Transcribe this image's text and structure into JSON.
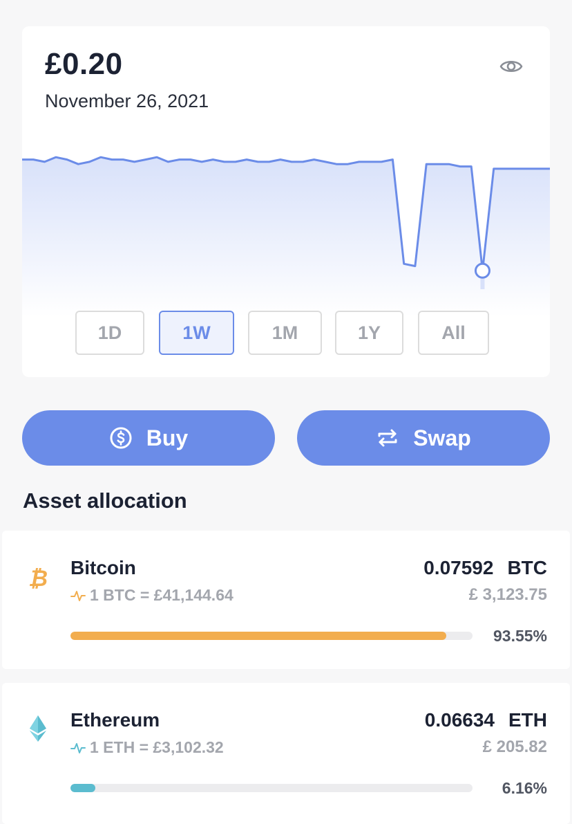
{
  "summary": {
    "balance": "£0.20",
    "date": "November 26, 2021",
    "visibility_icon": "eye-icon",
    "chart_data": {
      "type": "area",
      "description_points": [
        {
          "series": "portfolio",
          "selected_index": 41
        }
      ],
      "y": [
        0.5,
        0.5,
        0.49,
        0.51,
        0.5,
        0.48,
        0.49,
        0.51,
        0.5,
        0.5,
        0.49,
        0.5,
        0.51,
        0.49,
        0.5,
        0.5,
        0.49,
        0.5,
        0.49,
        0.49,
        0.5,
        0.49,
        0.49,
        0.5,
        0.49,
        0.49,
        0.5,
        0.49,
        0.48,
        0.48,
        0.49,
        0.49,
        0.49,
        0.5,
        0.05,
        0.04,
        0.48,
        0.48,
        0.48,
        0.47,
        0.47,
        0.02,
        0.46,
        0.46,
        0.46,
        0.46,
        0.46,
        0.46
      ],
      "line_color": "#6b8ce8",
      "fill_color": "#e3e9fb"
    },
    "ranges": [
      {
        "label": "1D",
        "active": false
      },
      {
        "label": "1W",
        "active": true
      },
      {
        "label": "1M",
        "active": false
      },
      {
        "label": "1Y",
        "active": false
      },
      {
        "label": "All",
        "active": false
      }
    ]
  },
  "actions": {
    "buy_label": "Buy",
    "buy_icon": "dollar-circle-icon",
    "swap_label": "Swap",
    "swap_icon": "swap-arrows-icon",
    "accent": "#6b8ce8"
  },
  "allocation": {
    "title": "Asset allocation",
    "assets": [
      {
        "name": "Bitcoin",
        "icon": "bitcoin-icon",
        "rate": "1 BTC = £41,144.64",
        "amount": "0.07592",
        "symbol": "BTC",
        "value": "£ 3,123.75",
        "percent": "93.55%",
        "share": 0.9355,
        "color": "#f2ad4e"
      },
      {
        "name": "Ethereum",
        "icon": "ethereum-icon",
        "rate": "1 ETH = £3,102.32",
        "amount": "0.06634",
        "symbol": "ETH",
        "value": "£ 205.82",
        "percent": "6.16%",
        "share": 0.0616,
        "color": "#5bbccf"
      }
    ]
  }
}
